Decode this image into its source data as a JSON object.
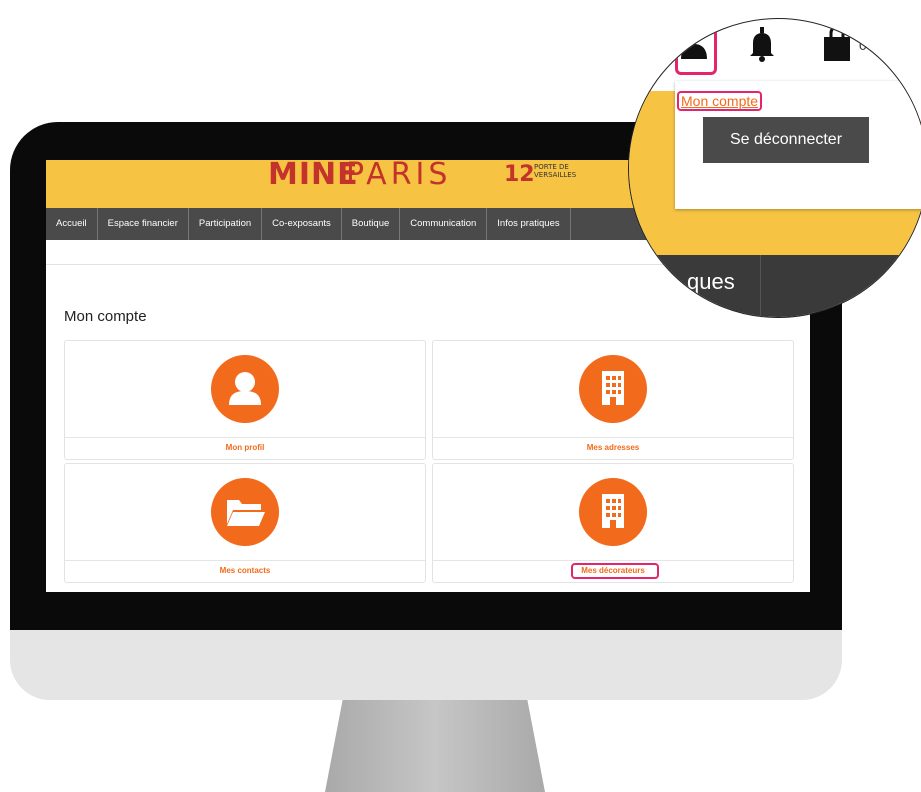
{
  "brand": {
    "logo_part1": "MINE",
    "logo_part2": "PARIS",
    "logo_number": "12",
    "logo_sub_line1": "PORTE DE",
    "logo_sub_line2": "VERSAILLES"
  },
  "nav": {
    "items": [
      "Accueil",
      "Espace financier",
      "Participation",
      "Co-exposants",
      "Boutique",
      "Communication",
      "Infos pratiques"
    ]
  },
  "page": {
    "title": "Mon compte"
  },
  "cards": [
    {
      "label": "Mon profil",
      "icon": "user-icon"
    },
    {
      "label": "Mes adresses",
      "icon": "building-icon"
    },
    {
      "label": "Mes contacts",
      "icon": "folder-icon"
    },
    {
      "label": "Mes décorateurs",
      "icon": "building-icon"
    }
  ],
  "zoom": {
    "account_link": "Mon compte",
    "logout_button": "Se déconnecter",
    "cart_count": "0",
    "nav_fragment": "ques"
  },
  "colors": {
    "accent": "#f26a1b",
    "header": "#f6c343",
    "nav": "#4a4a4a",
    "highlight": "#e4256b"
  }
}
